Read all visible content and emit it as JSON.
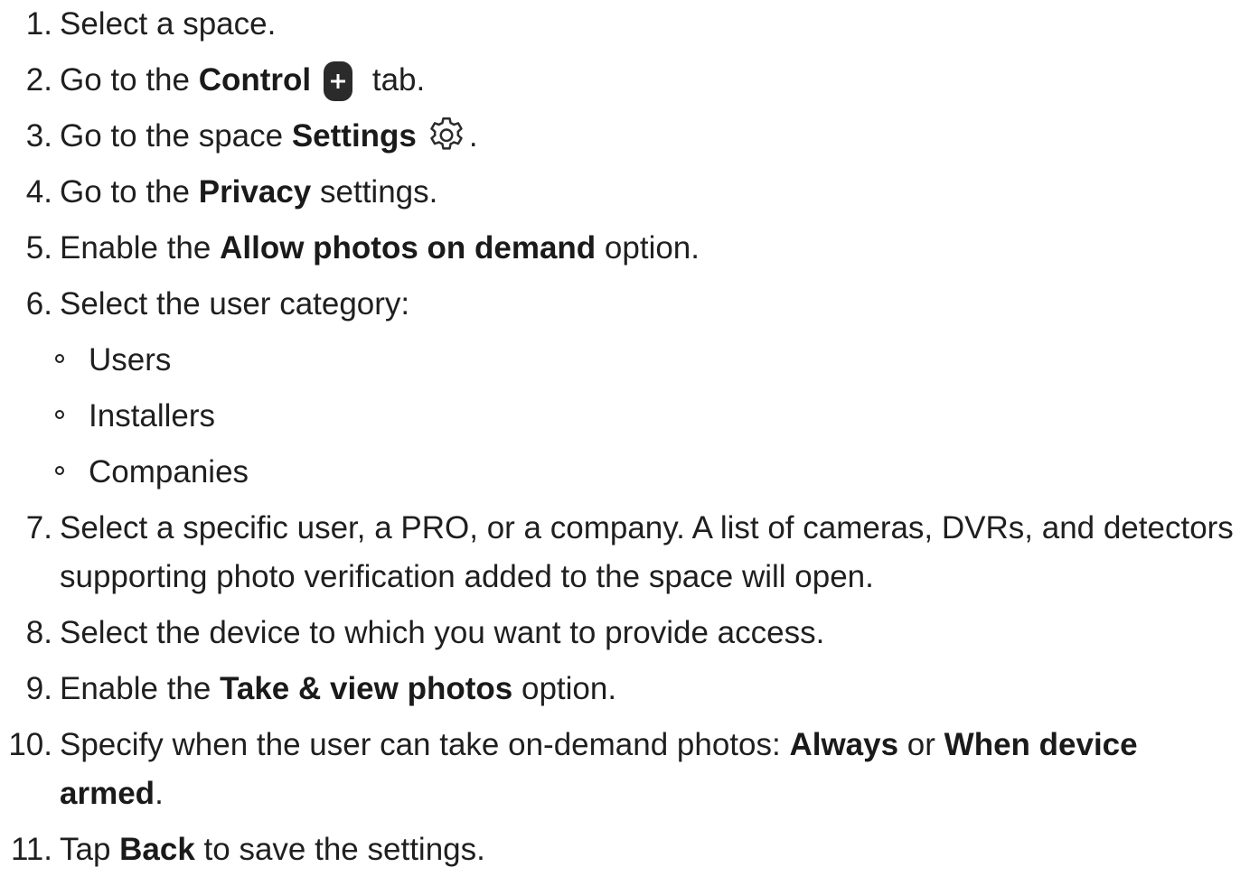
{
  "steps": [
    {
      "num": "1.",
      "parts": [
        "Select a space."
      ]
    },
    {
      "num": "2.",
      "pre": "Go to the ",
      "bold": "Control",
      "post": " tab."
    },
    {
      "num": "3.",
      "pre": "Go to the space ",
      "bold": "Settings",
      "post": "."
    },
    {
      "num": "4.",
      "pre": "Go to the ",
      "bold": "Privacy",
      "post": " settings."
    },
    {
      "num": "5.",
      "pre": "Enable the ",
      "bold": "Allow photos on demand",
      "post": " option."
    },
    {
      "num": "6.",
      "text": "Select the user category:",
      "sub": [
        "Users",
        "Installers",
        "Companies"
      ]
    },
    {
      "num": "7.",
      "text": "Select a specific user, a PRO, or a company. A list of cameras, DVRs, and detectors supporting photo verification added to the space will open."
    },
    {
      "num": "8.",
      "text": "Select the device to which you want to provide access."
    },
    {
      "num": "9.",
      "pre": "Enable the ",
      "bold": "Take & view photos",
      "post": " option."
    },
    {
      "num": "10.",
      "pre": "Specify when the user can take on-demand photos: ",
      "bold": "Always",
      "mid": " or ",
      "bold2": "When device armed",
      "post": "."
    },
    {
      "num": "11.",
      "pre": "Tap ",
      "bold": "Back",
      "post": " to save the settings."
    }
  ],
  "icons": {
    "control_tab": "plus-icon",
    "settings": "gear-icon"
  }
}
